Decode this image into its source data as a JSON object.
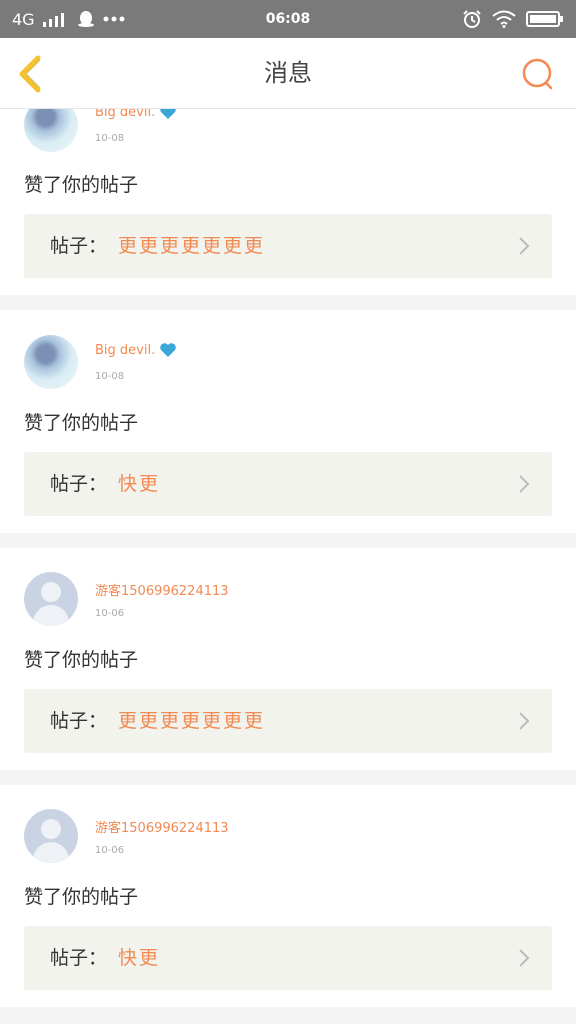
{
  "status_bar": {
    "network": "4G",
    "time": "06:08"
  },
  "header": {
    "title": "消息"
  },
  "colors": {
    "accent": "#f28a52",
    "back_icon": "#f4c430",
    "heart": "#3aa7d8"
  },
  "notifications": [
    {
      "username": "Big devil.",
      "date": "10-08",
      "action": "赞了你的帖子",
      "post_label": "帖子：",
      "post_title": "更更更更更更更",
      "avatar": "photo",
      "badge": "heart-icon"
    },
    {
      "username": "Big devil.",
      "date": "10-08",
      "action": "赞了你的帖子",
      "post_label": "帖子：",
      "post_title": "快更",
      "avatar": "photo",
      "badge": "heart-icon"
    },
    {
      "username": "游客1506996224113",
      "date": "10-06",
      "action": "赞了你的帖子",
      "post_label": "帖子：",
      "post_title": "更更更更更更更",
      "avatar": "default"
    },
    {
      "username": "游客1506996224113",
      "date": "10-06",
      "action": "赞了你的帖子",
      "post_label": "帖子：",
      "post_title": "快更",
      "avatar": "default"
    }
  ]
}
